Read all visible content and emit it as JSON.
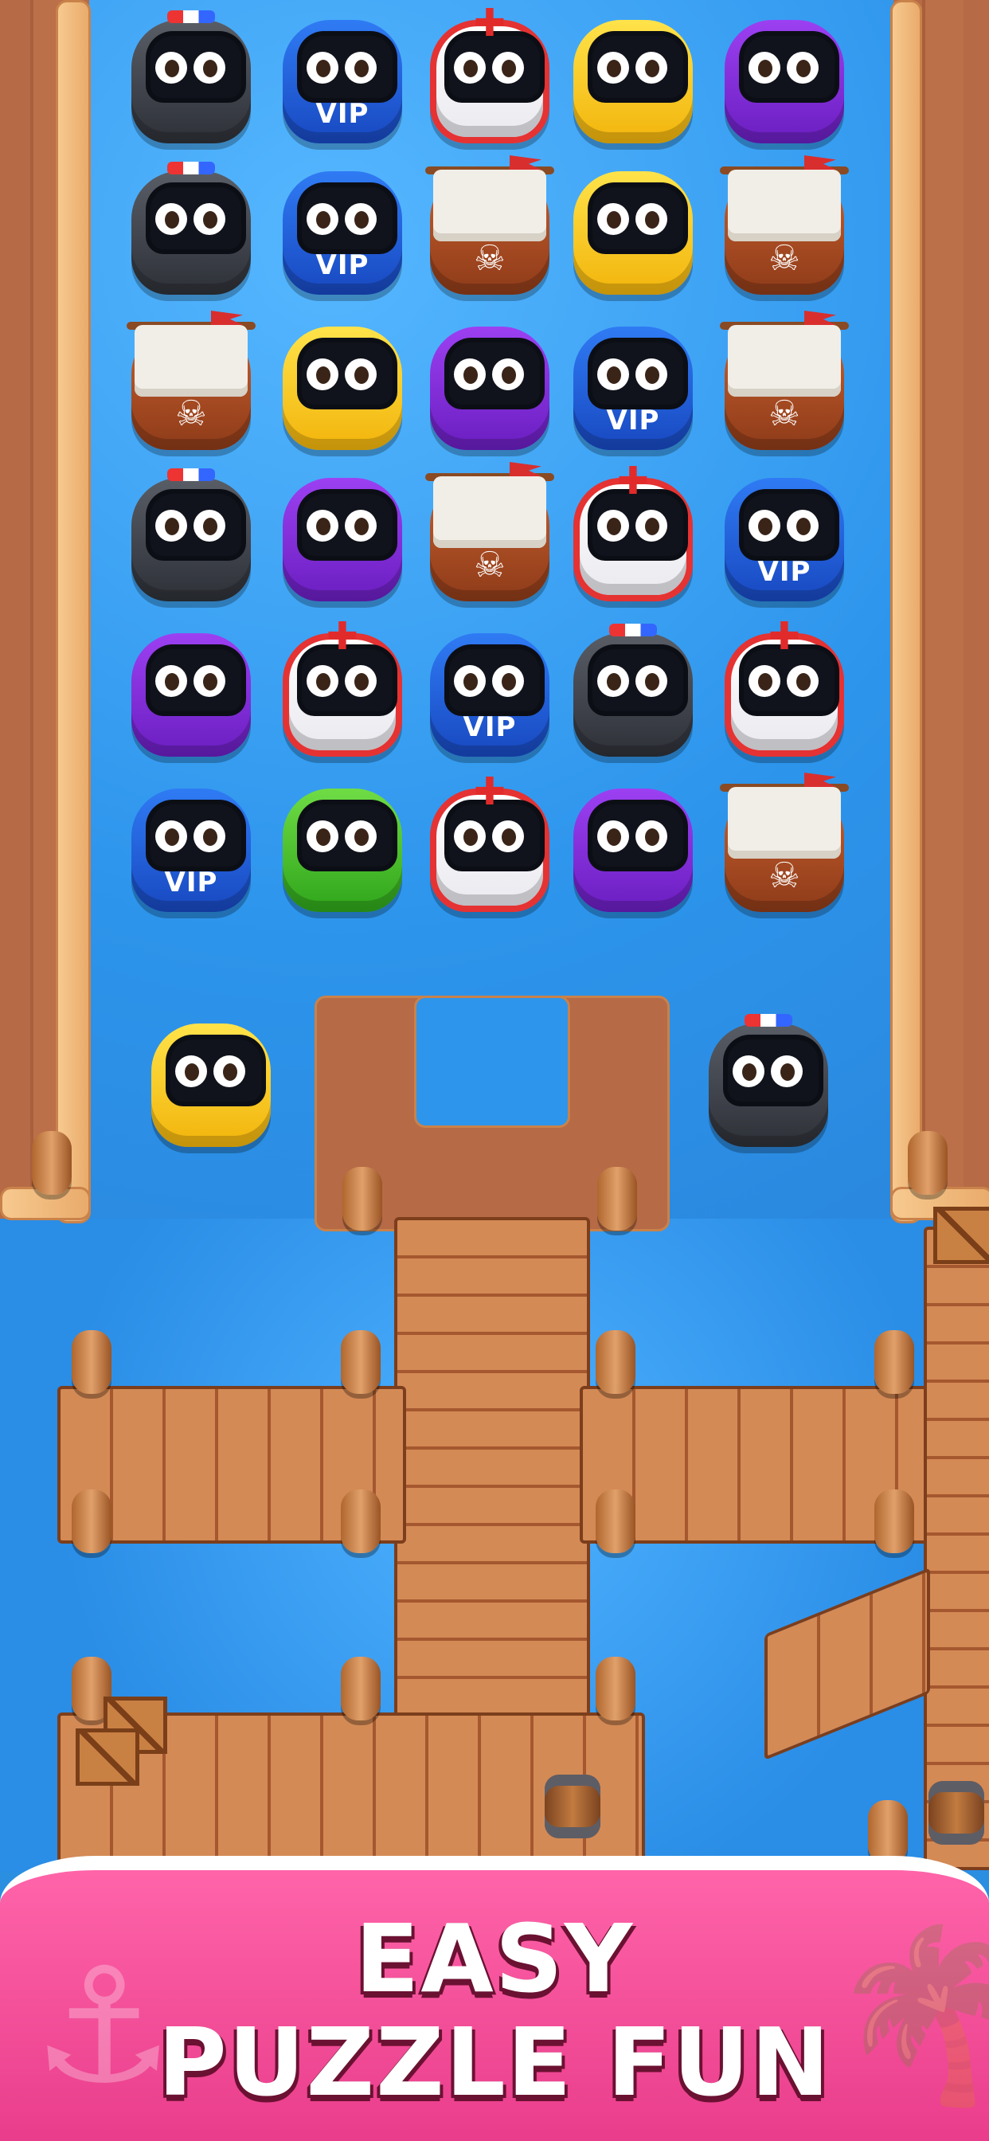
{
  "banner": {
    "line1": "EASY",
    "line2": "PUZZLE FUN"
  },
  "board": {
    "rows": [
      [
        {
          "kind": "police",
          "label": ""
        },
        {
          "kind": "vip",
          "label": "VIP"
        },
        {
          "kind": "ambulance",
          "label": ""
        },
        {
          "kind": "taxi",
          "label": ""
        },
        {
          "kind": "purple",
          "label": ""
        }
      ],
      [
        {
          "kind": "police",
          "label": ""
        },
        {
          "kind": "vip",
          "label": "VIP"
        },
        {
          "kind": "pirate",
          "label": ""
        },
        {
          "kind": "taxi",
          "label": ""
        },
        {
          "kind": "pirate",
          "label": ""
        }
      ],
      [
        {
          "kind": "pirate",
          "label": ""
        },
        {
          "kind": "taxi",
          "label": ""
        },
        {
          "kind": "purple",
          "label": ""
        },
        {
          "kind": "vip",
          "label": "VIP"
        },
        {
          "kind": "pirate",
          "label": ""
        }
      ],
      [
        {
          "kind": "police",
          "label": ""
        },
        {
          "kind": "purple",
          "label": ""
        },
        {
          "kind": "pirate",
          "label": ""
        },
        {
          "kind": "ambulance",
          "label": ""
        },
        {
          "kind": "vip",
          "label": "VIP"
        }
      ],
      [
        {
          "kind": "purple",
          "label": ""
        },
        {
          "kind": "ambulance",
          "label": ""
        },
        {
          "kind": "vip",
          "label": "VIP"
        },
        {
          "kind": "police",
          "label": ""
        },
        {
          "kind": "ambulance",
          "label": ""
        }
      ],
      [
        {
          "kind": "vip",
          "label": "VIP"
        },
        {
          "kind": "green",
          "label": ""
        },
        {
          "kind": "ambulance",
          "label": ""
        },
        {
          "kind": "purple",
          "label": ""
        },
        {
          "kind": "pirate",
          "label": ""
        }
      ]
    ],
    "exit_boats": [
      {
        "kind": "taxi",
        "label": ""
      },
      {
        "kind": "police",
        "label": ""
      }
    ]
  },
  "colors": {
    "police": "#3a3d45",
    "vip": "#1f5fd8",
    "ambulance": "#e53232",
    "taxi": "#f7c615",
    "purple": "#7f2fd9",
    "pirate": "#a44a22",
    "green": "#45c12b",
    "water": "#2a8fe0",
    "banner": "#f24f9a"
  },
  "icons": {
    "ambulance": "red-cross-icon",
    "police": "siren-icon",
    "pirate": "skull-flag-icon",
    "banner_left": "anchor-icon",
    "banner_right": "palm-tree-icon"
  }
}
